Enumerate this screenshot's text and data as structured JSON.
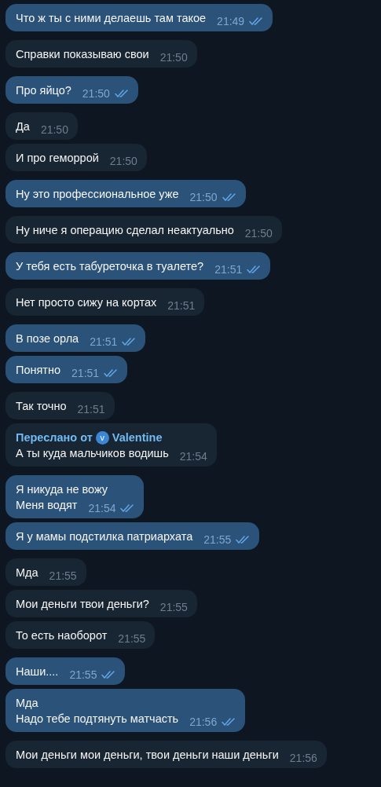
{
  "messages": [
    {
      "kind": "out",
      "lines": [
        "Что ж ты с ними делаешь там такое"
      ],
      "time": "21:49",
      "read": true
    },
    {
      "kind": "in",
      "lines": [
        "Справки показываю свои"
      ],
      "time": "21:50"
    },
    {
      "kind": "out",
      "lines": [
        "Про яйцо?"
      ],
      "time": "21:50",
      "read": true
    },
    {
      "kind": "in",
      "lines": [
        "Да"
      ],
      "time": "21:50"
    },
    {
      "kind": "in",
      "lines": [
        "И про геморрой"
      ],
      "time": "21:50"
    },
    {
      "kind": "out",
      "lines": [
        "Ну это профессиональное уже"
      ],
      "time": "21:50",
      "read": true
    },
    {
      "kind": "in",
      "lines": [
        "Ну ниче я операцию сделал неактуально"
      ],
      "time": "21:50"
    },
    {
      "kind": "out",
      "lines": [
        "У тебя есть табуреточка в туалете?"
      ],
      "time": "21:51",
      "read": true
    },
    {
      "kind": "in",
      "lines": [
        "Нет просто сижу на кортах"
      ],
      "time": "21:51"
    },
    {
      "kind": "out",
      "lines": [
        "В позе орла"
      ],
      "time": "21:51",
      "read": true
    },
    {
      "kind": "out",
      "lines": [
        "Понятно"
      ],
      "time": "21:51",
      "read": true
    },
    {
      "kind": "in",
      "lines": [
        "Так точно"
      ],
      "time": "21:51"
    },
    {
      "kind": "in",
      "forward": {
        "label": "Переслано от",
        "avatar": "v",
        "name": "Valentine"
      },
      "lines": [
        "А ты куда мальчиков водишь"
      ],
      "time": "21:54"
    },
    {
      "kind": "out",
      "lines": [
        "Я никуда не вожу",
        "Меня водят"
      ],
      "time": "21:54",
      "read": true
    },
    {
      "kind": "out",
      "lines": [
        "Я у мамы подстилка патриархата"
      ],
      "time": "21:55",
      "read": true
    },
    {
      "kind": "in",
      "lines": [
        "Мда"
      ],
      "time": "21:55"
    },
    {
      "kind": "in",
      "lines": [
        "Мои деньги твои деньги?"
      ],
      "time": "21:55"
    },
    {
      "kind": "in",
      "lines": [
        "То есть наоборот"
      ],
      "time": "21:55"
    },
    {
      "kind": "out",
      "lines": [
        "Наши...."
      ],
      "time": "21:55",
      "read": true
    },
    {
      "kind": "out",
      "lines": [
        "Мда",
        "Надо тебе подтянуть матчасть"
      ],
      "time": "21:56",
      "read": true
    },
    {
      "kind": "in",
      "lines": [
        "Мои деньги мои деньги, твои деньги наши деньги"
      ],
      "time": "21:56"
    }
  ]
}
